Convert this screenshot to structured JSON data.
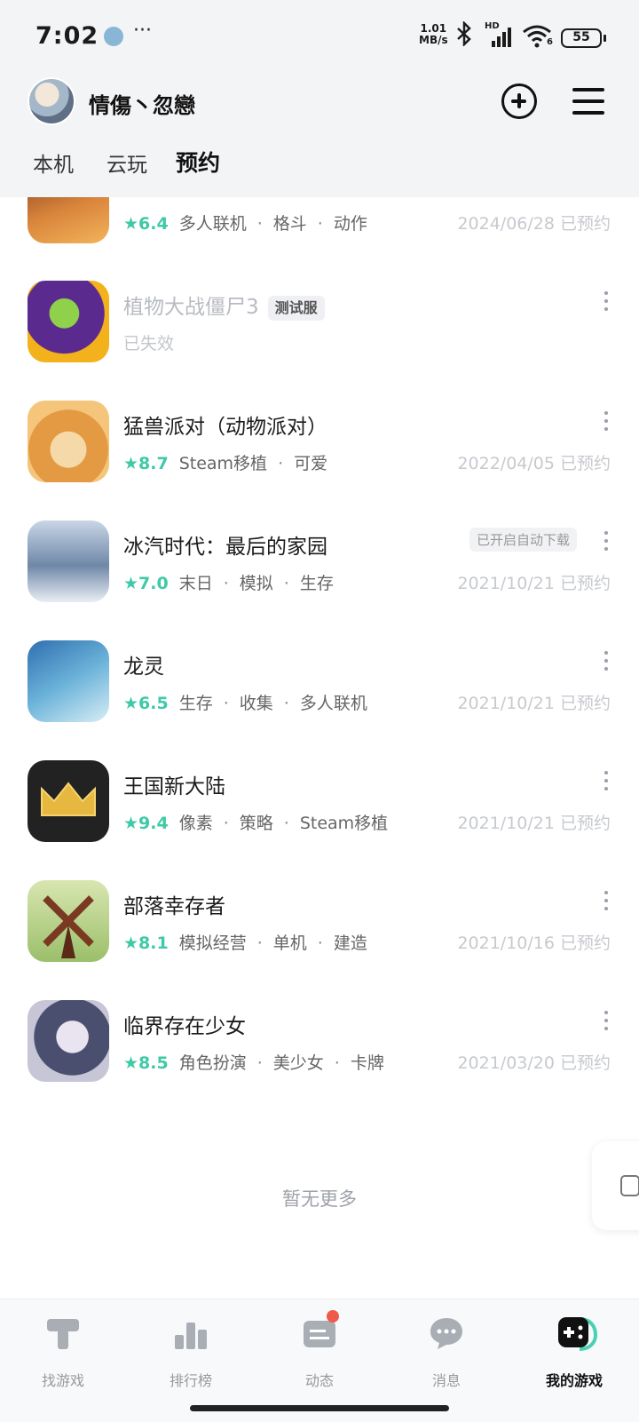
{
  "status_bar": {
    "time": "7:02",
    "dots": "···",
    "speed_value": "1.01",
    "speed_unit": "MB/s",
    "bluetooth": "bluetooth-icon",
    "hd": "HD",
    "wifi_badge": "6",
    "battery": "55"
  },
  "user": {
    "name": "情傷丶忽戀"
  },
  "tabs": [
    "本机",
    "云玩",
    "预约"
  ],
  "games": [
    {
      "title": "",
      "rating": "★6.4",
      "tags": [
        "多人联机",
        "格斗",
        "动作"
      ],
      "date": "2024/06/28 已预约"
    },
    {
      "title": "植物大战僵尸3",
      "badge": "测试服",
      "status": "已失效"
    },
    {
      "title": "猛兽派对（动物派对）",
      "rating": "★8.7",
      "tags": [
        "Steam移植",
        "可爱"
      ],
      "date": "2022/04/05 已预约"
    },
    {
      "title": "冰汽时代：最后的家园",
      "rating": "★7.0",
      "tags": [
        "末日",
        "模拟",
        "生存"
      ],
      "date": "2021/10/21 已预约",
      "auto": "已开启自动下载"
    },
    {
      "title": "龙灵",
      "rating": "★6.5",
      "tags": [
        "生存",
        "收集",
        "多人联机"
      ],
      "date": "2021/10/21 已预约"
    },
    {
      "title": "王国新大陆",
      "rating": "★9.4",
      "tags": [
        "像素",
        "策略",
        "Steam移植"
      ],
      "date": "2021/10/21 已预约"
    },
    {
      "title": "部落幸存者",
      "rating": "★8.1",
      "tags": [
        "模拟经营",
        "单机",
        "建造"
      ],
      "date": "2021/10/16 已预约"
    },
    {
      "title": "临界存在少女",
      "rating": "★8.5",
      "tags": [
        "角色扮演",
        "美少女",
        "卡牌"
      ],
      "date": "2021/03/20 已预约"
    }
  ],
  "no_more": "暂无更多",
  "bottom_nav": [
    "找游戏",
    "排行榜",
    "动态",
    "消息",
    "我的游戏"
  ],
  "colors": {
    "accent": "#3fc9a6",
    "tab_highlight": "#48d1b3",
    "notify": "#f05a4a"
  }
}
